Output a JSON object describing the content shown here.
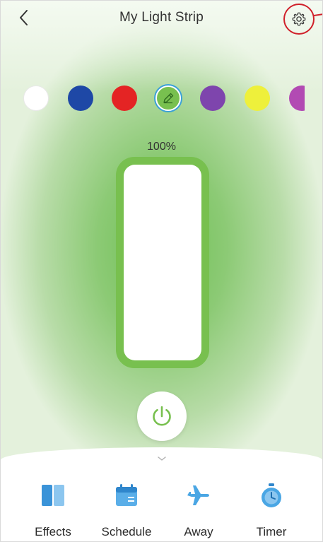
{
  "header": {
    "title": "My Light Strip",
    "back_icon": "chevron-left-icon",
    "settings_icon": "gear-icon"
  },
  "colors": {
    "accent": "#78c04f",
    "highlight_ring": "#d0202a",
    "selected_ring": "#3aa0d8",
    "tab_icon": "#4aa6e4"
  },
  "swatches": [
    {
      "name": "white",
      "color": "#ffffff"
    },
    {
      "name": "blue",
      "color": "#1e48a6"
    },
    {
      "name": "red",
      "color": "#e42424"
    },
    {
      "name": "green-custom",
      "color": "#78c04f",
      "selected": true,
      "icon": "pencil-icon"
    },
    {
      "name": "purple",
      "color": "#7e45ad"
    },
    {
      "name": "yellow",
      "color": "#eef03b"
    },
    {
      "name": "magenta",
      "color": "#b24ab3"
    }
  ],
  "brightness": {
    "label": "100%",
    "value": 100
  },
  "power": {
    "icon": "power-icon",
    "state": "on"
  },
  "bottom_bar": {
    "expand_icon": "chevron-down-icon",
    "tabs": [
      {
        "label": "Effects",
        "icon": "effects-icon"
      },
      {
        "label": "Schedule",
        "icon": "calendar-icon"
      },
      {
        "label": "Away",
        "icon": "airplane-icon"
      },
      {
        "label": "Timer",
        "icon": "stopwatch-icon"
      }
    ]
  }
}
